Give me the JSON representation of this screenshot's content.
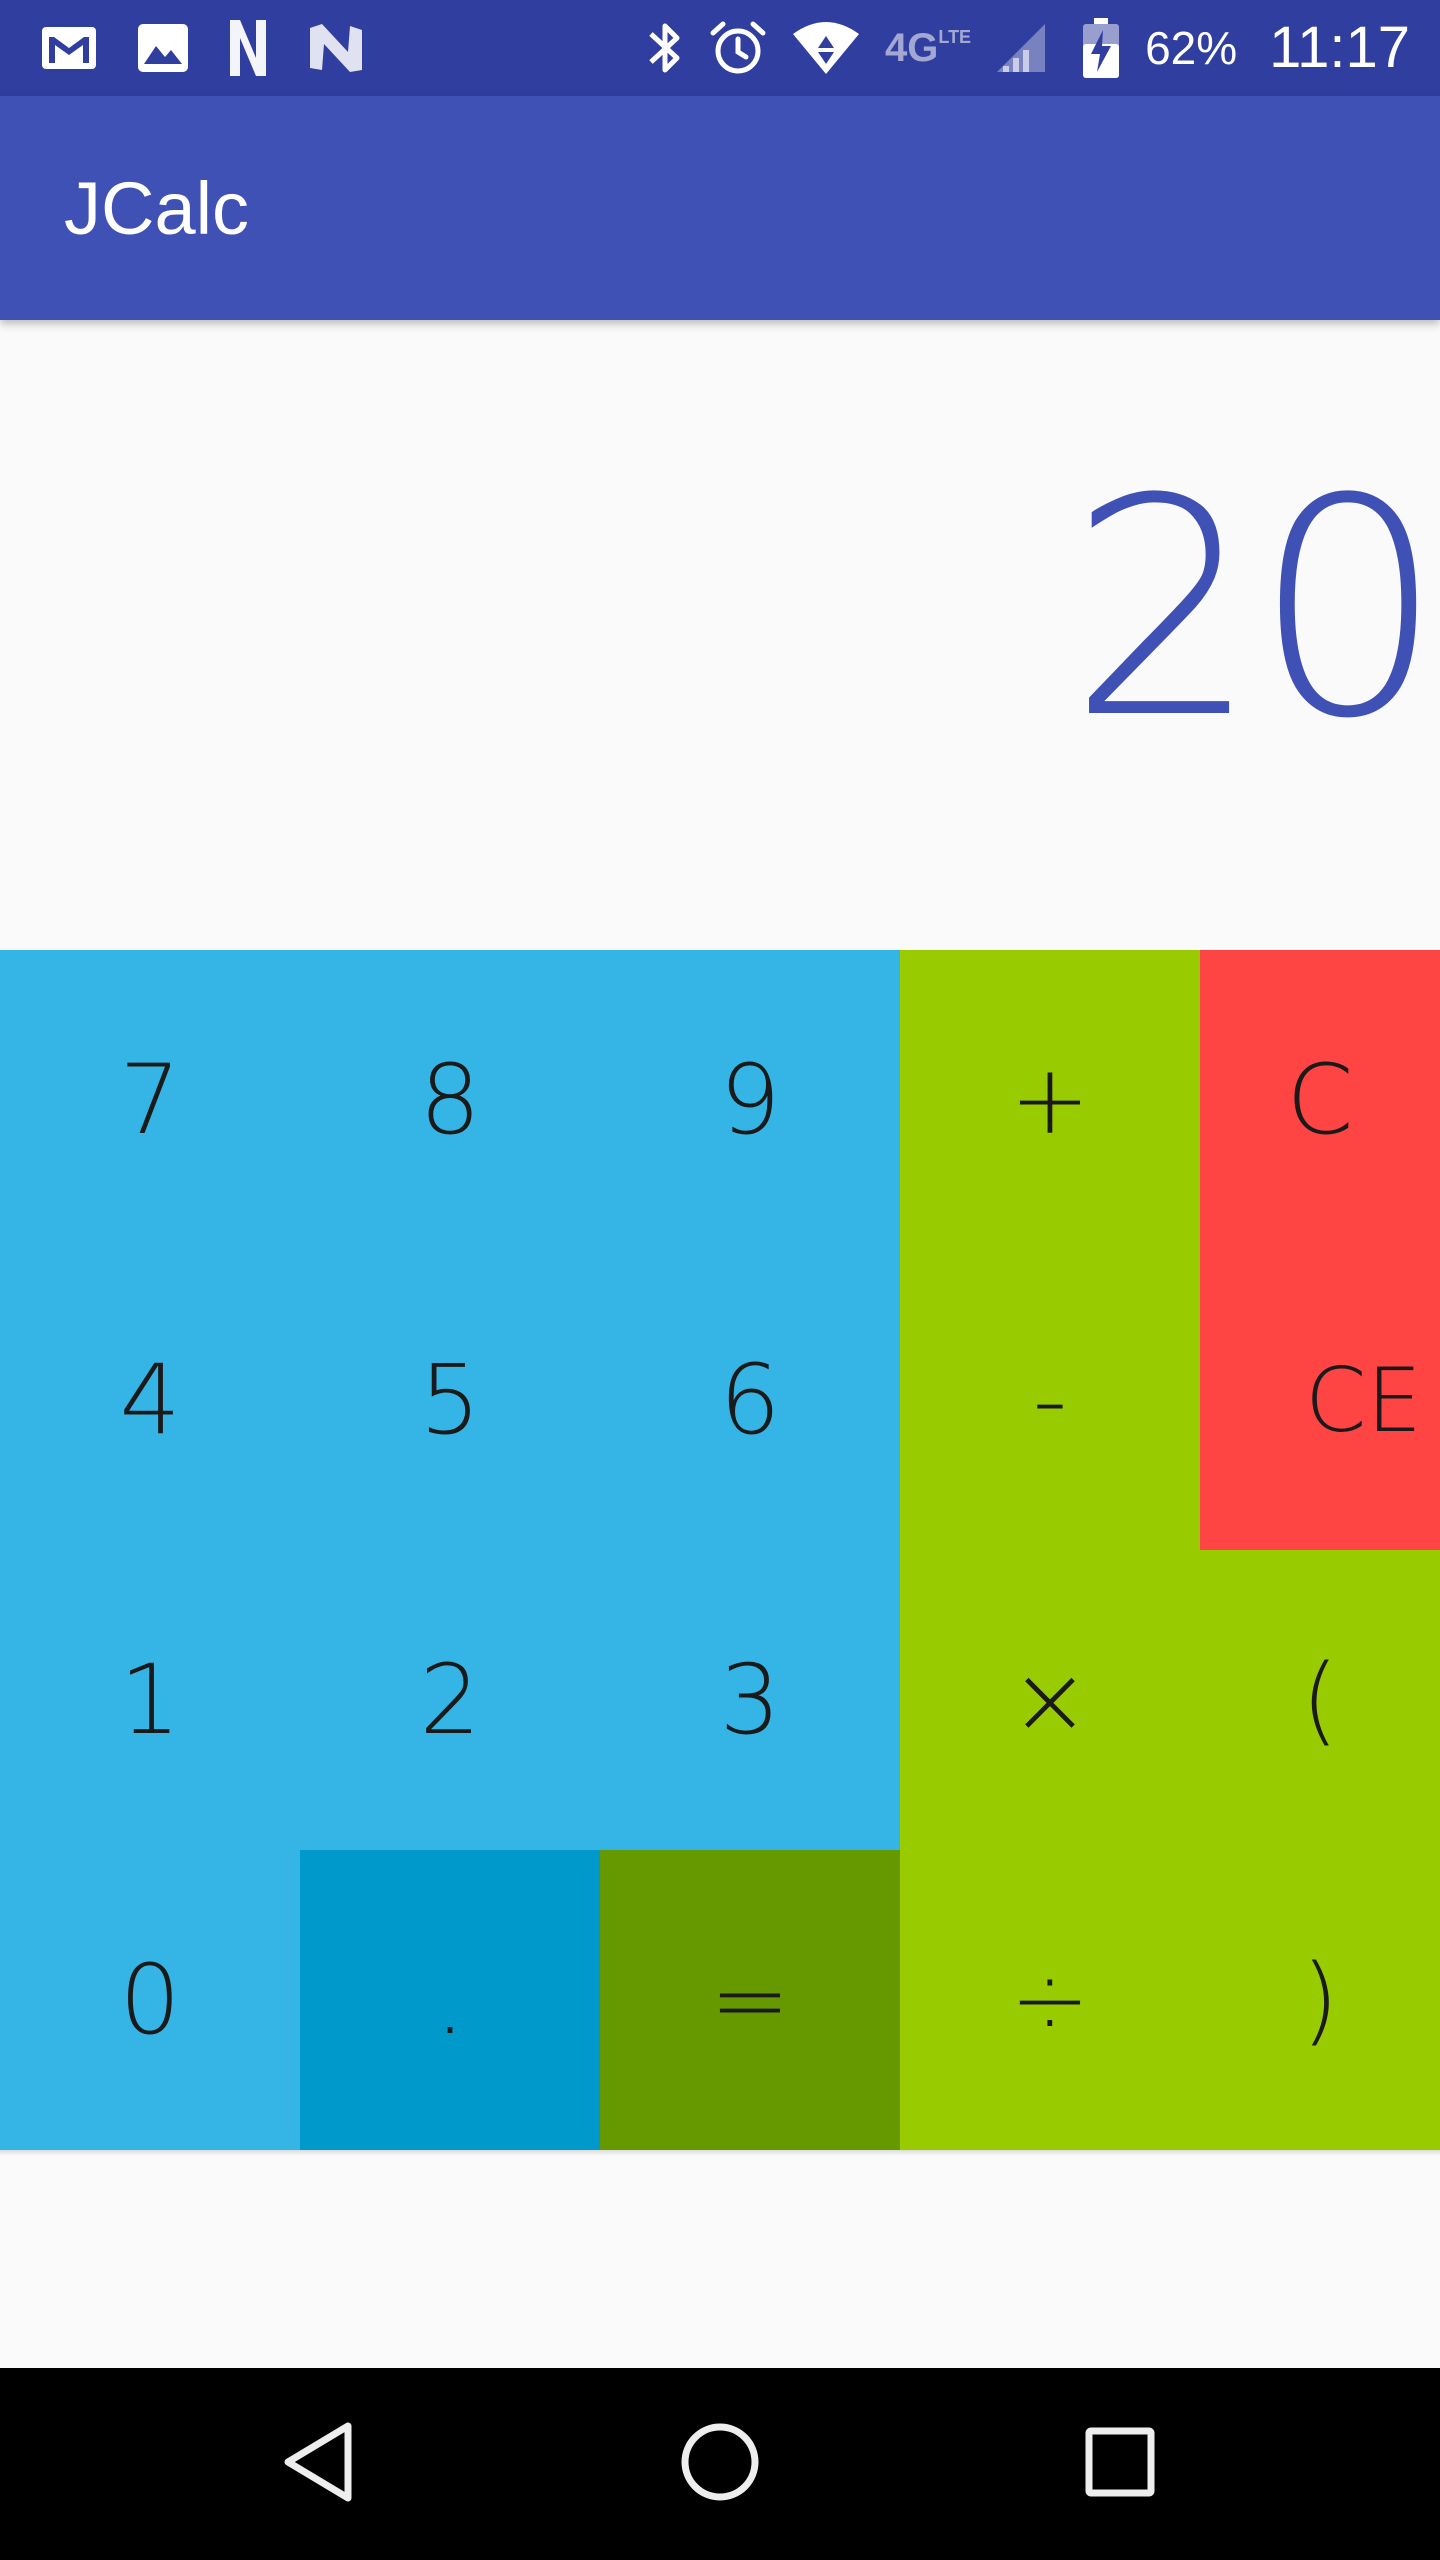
{
  "status_bar": {
    "battery": "62%",
    "time": "11:17",
    "network": "4G",
    "network_sub": "LTE",
    "left_icons": [
      "gmail-icon",
      "photos-icon",
      "n-logo-icon",
      "n-logo-icon"
    ],
    "right_icons": [
      "bluetooth-icon",
      "alarm-icon",
      "wifi-icon",
      "signal-icon",
      "battery-charging-icon"
    ]
  },
  "app_bar": {
    "title": "JCalc"
  },
  "display": {
    "value": "20"
  },
  "keypad": {
    "keys": {
      "k7": "7",
      "k8": "8",
      "k9": "9",
      "plus": "+",
      "clear": "C",
      "k4": "4",
      "k5": "5",
      "k6": "6",
      "minus": "-",
      "clear_entry": "CE",
      "k1": "1",
      "k2": "2",
      "k3": "3",
      "multiply": "×",
      "paren_open": "(",
      "k0": "0",
      "dot": ".",
      "equals": "=",
      "divide": "÷",
      "paren_close": ")"
    }
  },
  "nav_bar": {
    "buttons": [
      "back-icon",
      "home-icon",
      "recents-icon"
    ]
  },
  "colors": {
    "status_bar": "#303f9f",
    "app_bar": "#3f51b5",
    "display_text": "#3f51b5",
    "digits": "#35b5e5",
    "dot": "#0099cc",
    "operators": "#99cc00",
    "equals": "#669900",
    "clear": "#ff4444",
    "nav_bar": "#000000"
  }
}
